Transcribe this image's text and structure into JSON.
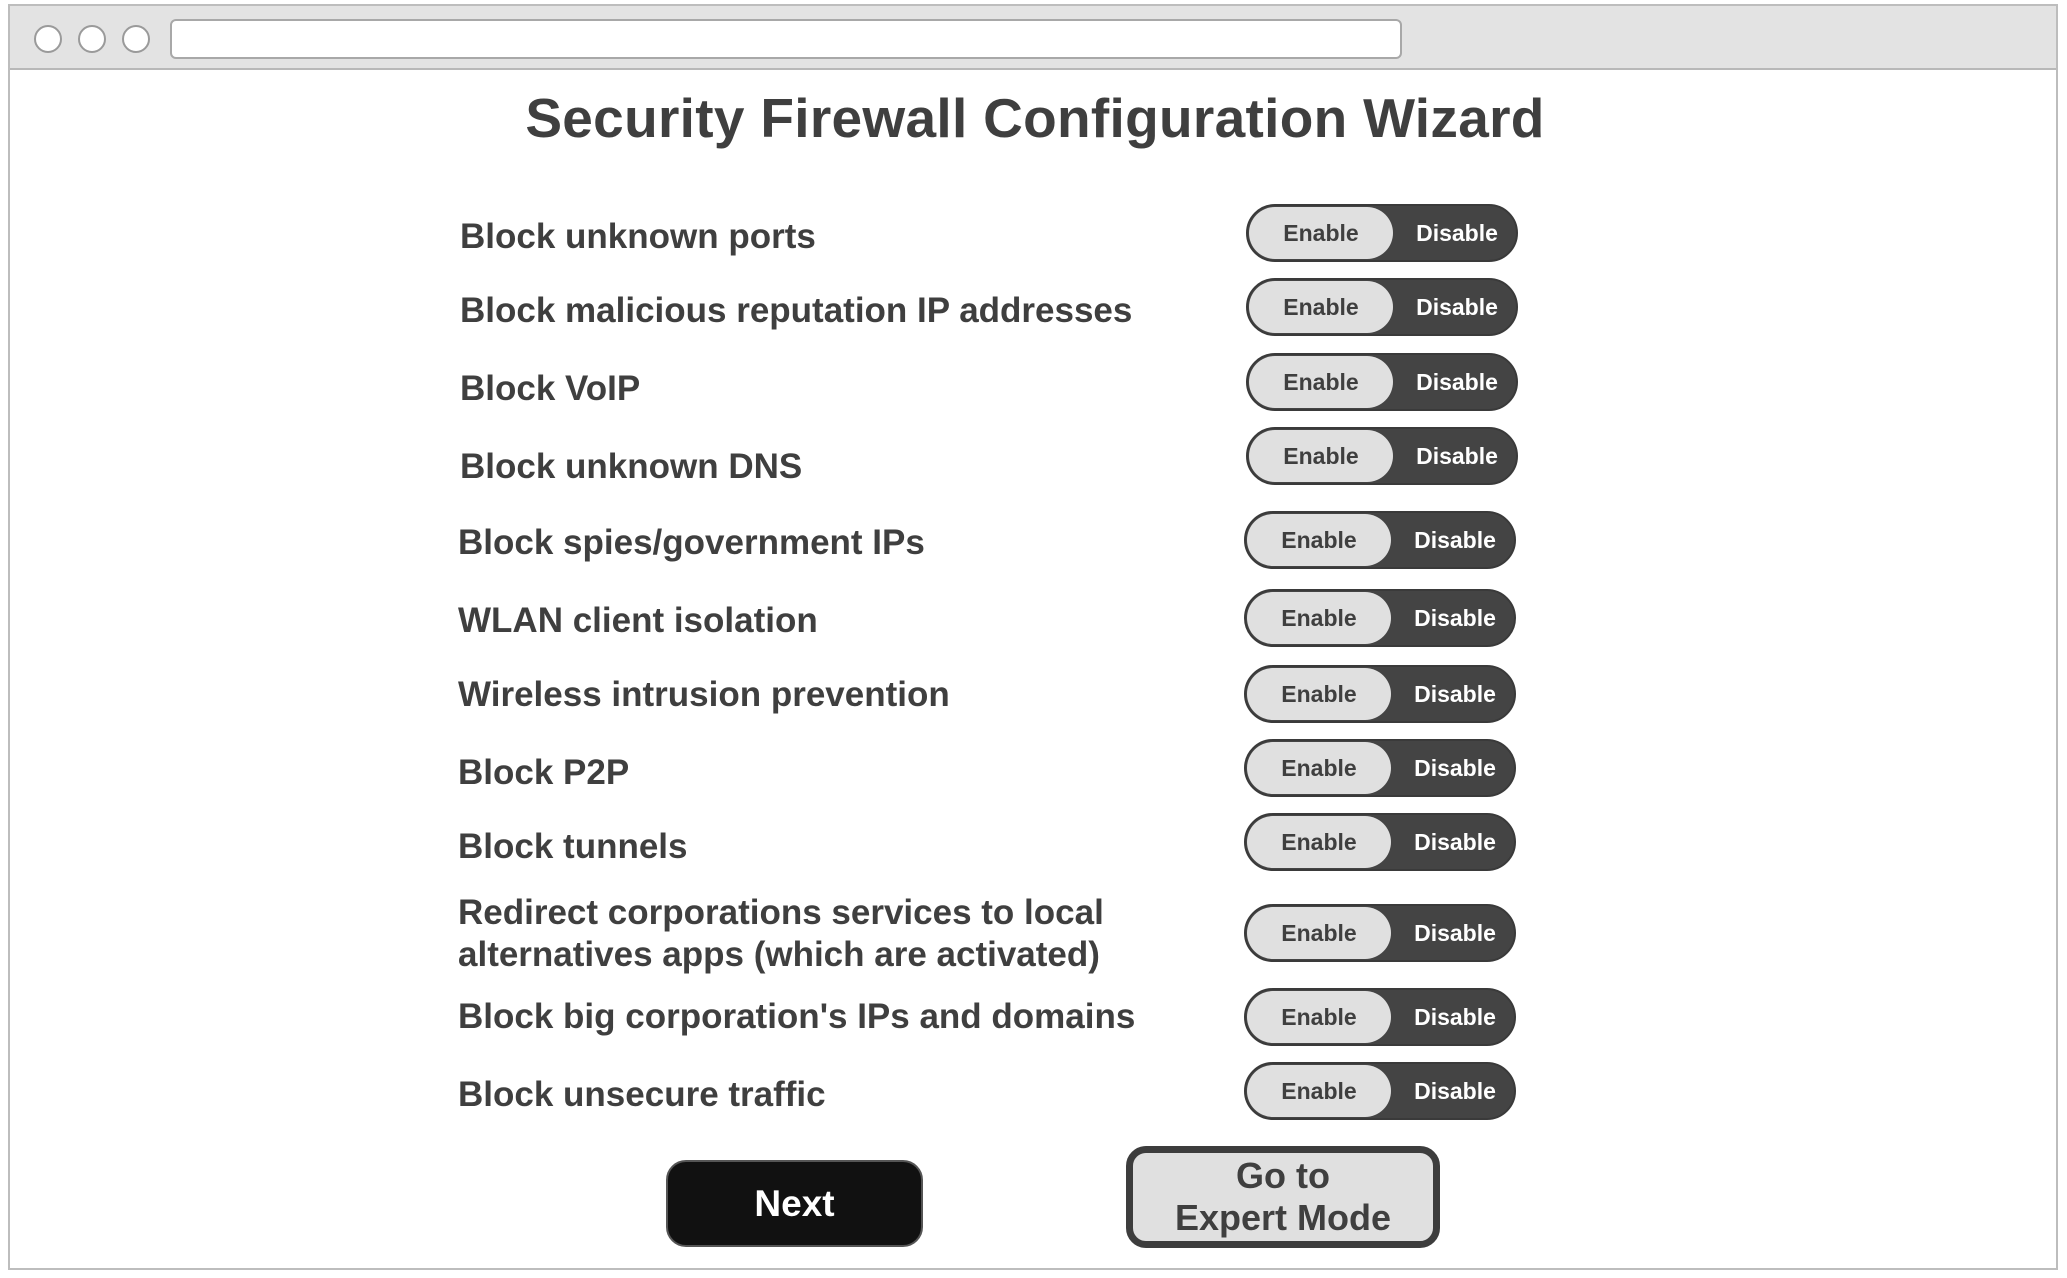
{
  "window": {
    "url": ""
  },
  "page": {
    "title": "Security Firewall Configuration Wizard"
  },
  "toggle_labels": {
    "enable": "Enable",
    "disable": "Disable"
  },
  "options": [
    {
      "label": "Block unknown ports",
      "state": "Disable"
    },
    {
      "label": "Block malicious reputation IP addresses",
      "state": "Disable"
    },
    {
      "label": "Block VoIP",
      "state": "Disable"
    },
    {
      "label": "Block unknown DNS",
      "state": "Disable"
    },
    {
      "label": "Block spies/government IPs",
      "state": "Disable"
    },
    {
      "label": "WLAN client isolation",
      "state": "Disable"
    },
    {
      "label": "Wireless intrusion prevention",
      "state": "Disable"
    },
    {
      "label": "Block P2P",
      "state": "Disable"
    },
    {
      "label": "Block tunnels",
      "state": "Disable"
    },
    {
      "label": "Redirect corporations services to local\nalternatives apps (which are activated)",
      "state": "Disable"
    },
    {
      "label": "Block big corporation's IPs and domains",
      "state": "Disable"
    },
    {
      "label": "Block unsecure traffic",
      "state": "Disable"
    }
  ],
  "buttons": {
    "next": "Next",
    "expert_mode": "Go to\nExpert Mode"
  },
  "colors": {
    "text": "#3f3f3f",
    "toggle_dark": "#444444",
    "toggle_light": "#e0e0e0",
    "next_button": "#111111"
  }
}
